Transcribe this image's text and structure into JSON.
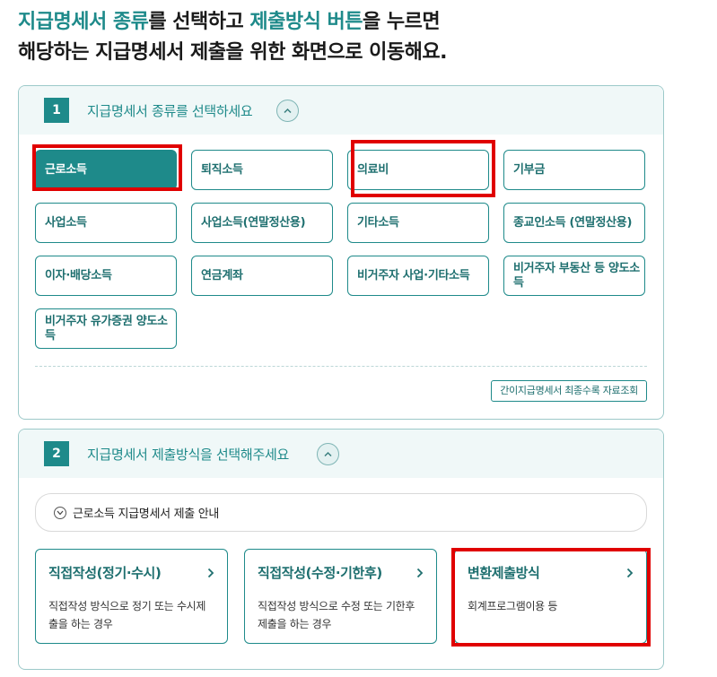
{
  "headline": {
    "l1_hl1": "지급명세서 종류",
    "l1_t1": "를 선택하고 ",
    "l1_hl2": "제출방식 버튼",
    "l1_t2": "을 누르면",
    "line2": "해당하는 지급명세서 제출을 위한 화면으로 이동해요."
  },
  "step1": {
    "number": "1",
    "title": "지급명세서 종류를 선택하세요",
    "types": [
      {
        "label": "근로소득",
        "selected": true
      },
      {
        "label": "퇴직소득"
      },
      {
        "label": "의료비"
      },
      {
        "label": "기부금"
      },
      {
        "label": "사업소득"
      },
      {
        "label": "사업소득(연말정산용)"
      },
      {
        "label": "기타소득"
      },
      {
        "label": "종교인소득 (연말정산용)"
      },
      {
        "label": "이자·배당소득"
      },
      {
        "label": "연금계좌"
      },
      {
        "label": "비거주자 사업·기타소득"
      },
      {
        "label": "비거주자 부동산 등 양도소득"
      },
      {
        "label": "비거주자 유가증권 양도소득"
      }
    ],
    "lookup_label": "간이지급명세서 최종수록 자료조회"
  },
  "step2": {
    "number": "2",
    "title": "지급명세서 제출방식을 선택해주세요",
    "guide_label": "근로소득 지급명세서 제출 안내",
    "methods": [
      {
        "title": "직접작성(정기·수시)",
        "desc": "직접작성 방식으로 정기 또는 수시제출을 하는 경우"
      },
      {
        "title": "직접작성(수정·기한후)",
        "desc": "직접작성 방식으로 수정 또는 기한후제출을 하는 경우"
      },
      {
        "title": "변환제출방식",
        "desc": "회계프로그램이용 등"
      }
    ]
  },
  "colors": {
    "accent": "#1e8a8a",
    "highlight_box": "#e00000"
  }
}
